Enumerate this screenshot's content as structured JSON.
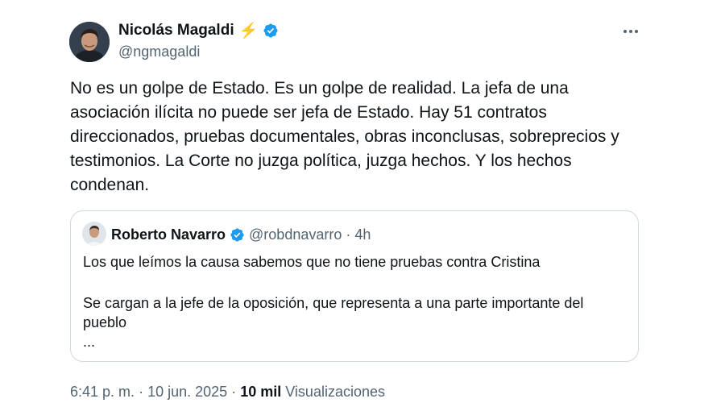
{
  "tweet": {
    "author": {
      "name": "Nicolás Magaldi",
      "emoji": "⚡",
      "handle": "@ngmagaldi",
      "verified": true
    },
    "text": "No es un golpe de Estado. Es un golpe de realidad. La jefa de una asociación ilícita no puede ser jefa de Estado. Hay 51 contratos direccionados, pruebas documentales, obras inconclusas, sobreprecios y testimonios. La Corte no juzga política, juzga hechos. Y los hechos condenan.",
    "quote": {
      "name": "Roberto Navarro",
      "handle": "@robdnavarro",
      "separator": "·",
      "time": "4h",
      "line1": "Los que leímos la causa sabemos que no tiene pruebas contra Cristina",
      "line2": "Se cargan a la jefe de la oposición, que representa a una parte importante del pueblo",
      "ellipsis": "..."
    },
    "footer": {
      "time": "6:41 p. m.",
      "sep1": "·",
      "date": "10 jun. 2025",
      "sep2": "·",
      "views_count": "10 mil",
      "views_label": "Visualizaciones"
    }
  },
  "icons": {
    "more": "more-horizontal-icon",
    "verified": "verified-badge-icon"
  },
  "colors": {
    "verified_blue": "#1d9bf0",
    "secondary_text": "#536471",
    "primary_text": "#0f1419",
    "border": "#cfd9de",
    "bolt": "#f4a21a"
  }
}
